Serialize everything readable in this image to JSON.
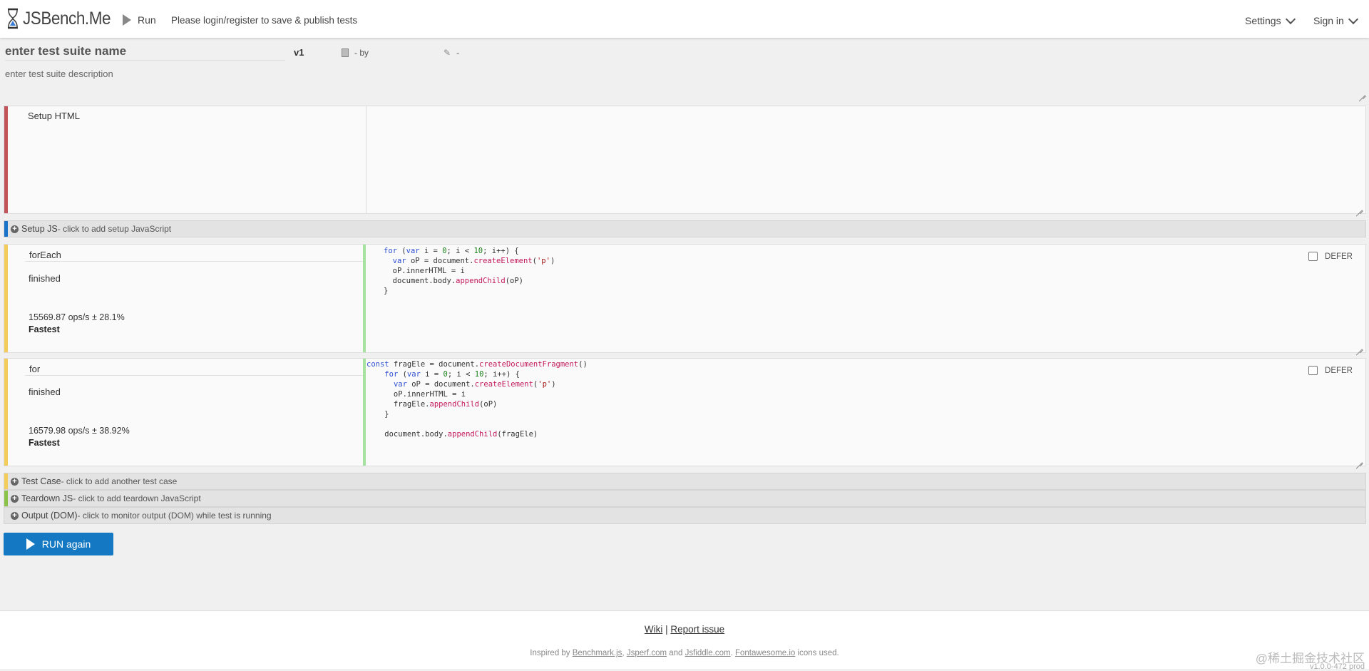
{
  "header": {
    "logo_text": "JSBench.Me",
    "run_label": "Run",
    "login_text": "Please login/register to save & publish tests",
    "settings_label": "Settings",
    "signin_label": "Sign in"
  },
  "suite": {
    "name_placeholder": "enter test suite name",
    "version": "v1",
    "by_text": "- by",
    "edit_text": "-",
    "description_placeholder": "enter test suite description"
  },
  "setup_html": {
    "label": "Setup HTML"
  },
  "setup_js": {
    "title": "Setup JS",
    "hint": " - click to add setup JavaScript"
  },
  "test_cases": [
    {
      "name": "forEach",
      "status": "finished",
      "ops": "15569.87 ops/s ± 28.1%",
      "rank": "Fastest",
      "defer_label": "DEFER"
    },
    {
      "name": "for",
      "status": "finished",
      "ops": "16579.98 ops/s ± 38.92%",
      "rank": "Fastest",
      "defer_label": "DEFER"
    }
  ],
  "add_rows": [
    {
      "title": "Test Case",
      "hint": " - click to add another test case"
    },
    {
      "title": "Teardown JS",
      "hint": " - click to add teardown JavaScript"
    },
    {
      "title": "Output (DOM)",
      "hint": " - click to monitor output (DOM) while test is running"
    }
  ],
  "run_again_label": "RUN again",
  "footer": {
    "wiki": "Wiki",
    "separator": "|",
    "report": "Report issue",
    "credit_prefix": "Inspired by ",
    "benchmark": "Benchmark.js",
    "jsperf": "Jsperf.com",
    "and": " and ",
    "jsfiddle": "Jsfiddle.com",
    "fontawesome": "Fontawesome.io",
    "credit_suffix": " icons used.",
    "watermark": "@稀土掘金技术社区",
    "build": "v1.0.0-472 prod"
  },
  "colors": {
    "setup_html_bar": "#c0555a",
    "setup_js_bar": "#1a73c9",
    "testcase_bar": "#f2cd5c",
    "teardown_bar": "#8bc34a",
    "code_separator": "#a6e3a1",
    "run_button": "#1479c2"
  }
}
